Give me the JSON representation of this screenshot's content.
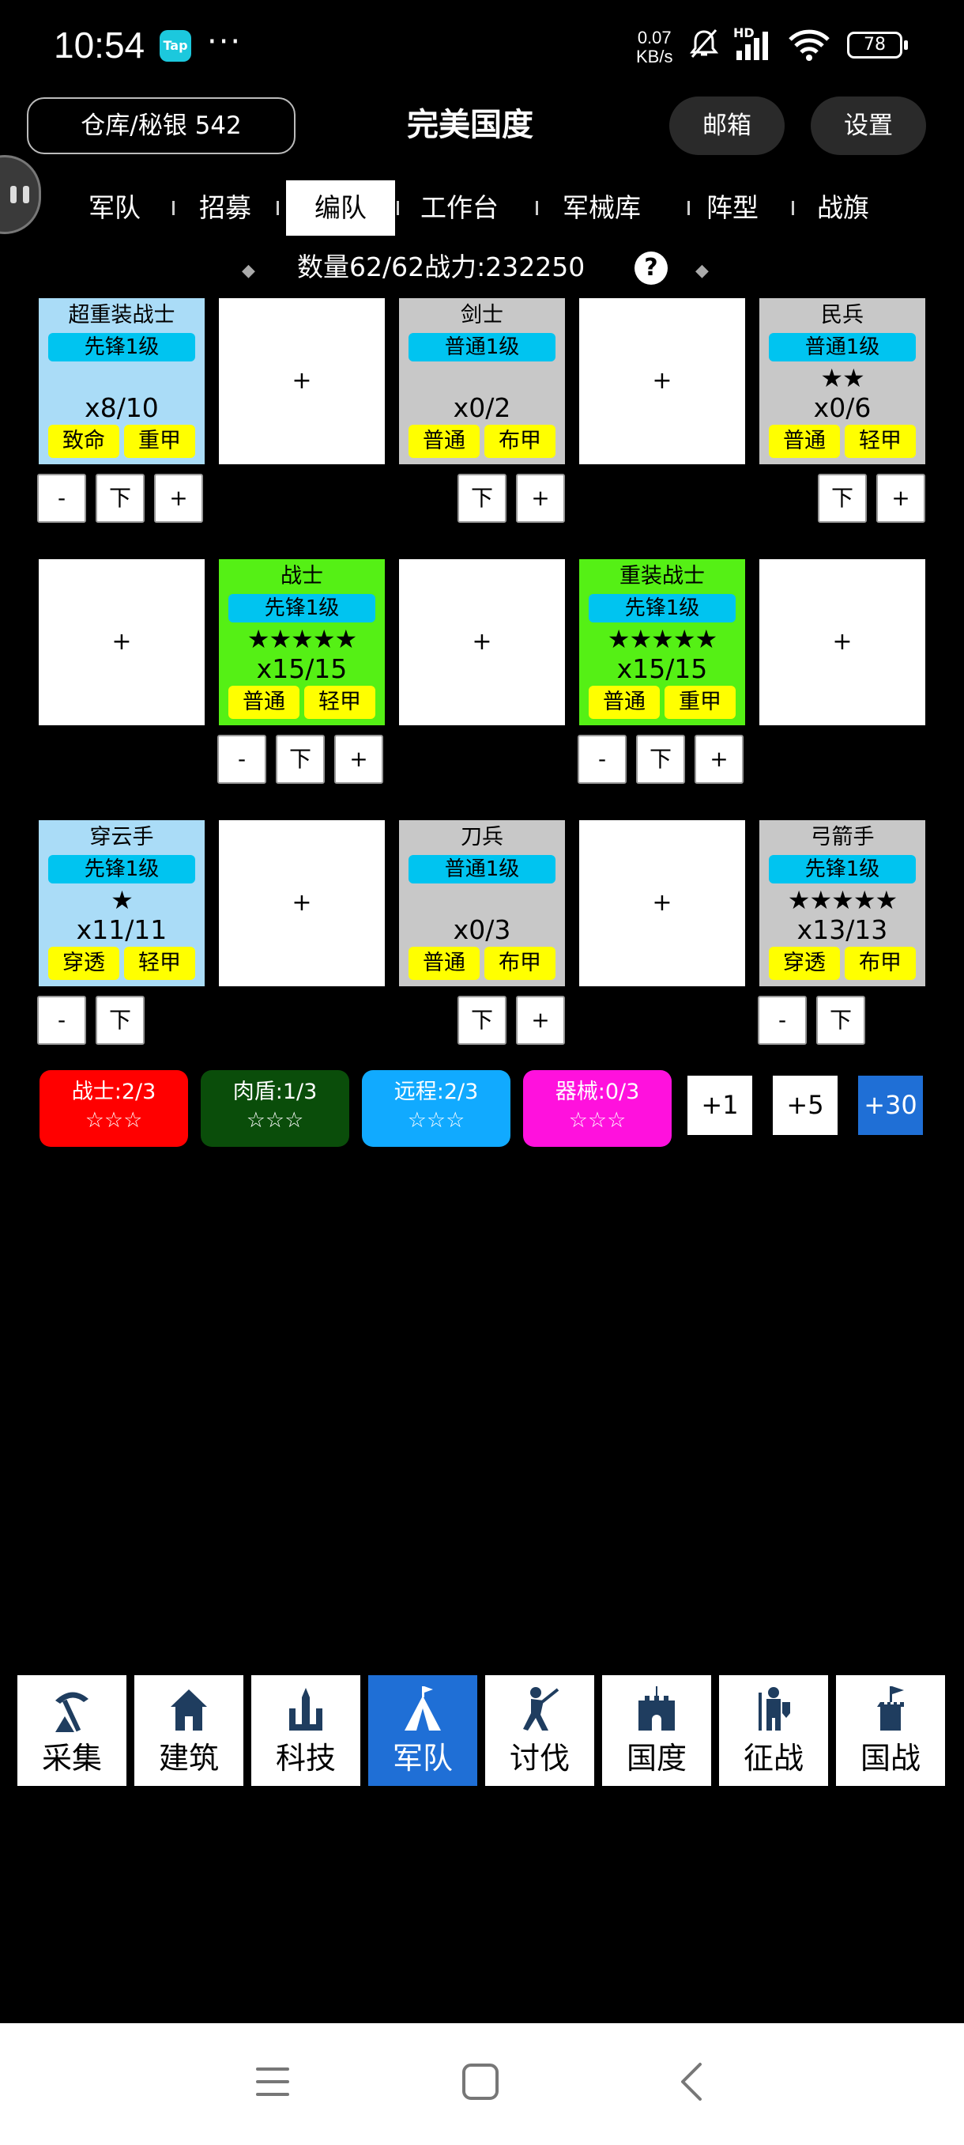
{
  "status_bar": {
    "time": "10:54",
    "tap_label": "Tap",
    "more": "···",
    "speed_value": "0.07",
    "speed_unit": "KB/s",
    "network_label": "HD",
    "battery": "78"
  },
  "header": {
    "warehouse": "仓库/秘银 542",
    "title": "完美国度",
    "mailbox": "邮箱",
    "settings": "设置"
  },
  "tabs": [
    {
      "label": "军队"
    },
    {
      "label": "招募"
    },
    {
      "label": "编队",
      "active": true
    },
    {
      "label": "工作台"
    },
    {
      "label": "军械库"
    },
    {
      "label": "阵型"
    },
    {
      "label": "战旗"
    }
  ],
  "summary": "数量62/62战力:232250",
  "help": "?",
  "slots": [
    {
      "name": "超重装战士",
      "rank": "先锋1级",
      "stars": "",
      "qty": "x8/10",
      "tags": [
        "致命",
        "重甲"
      ],
      "color": "#aadcf7",
      "buttons": [
        "-",
        "下",
        "+"
      ]
    },
    {
      "empty": "+"
    },
    {
      "name": "剑士",
      "rank": "普通1级",
      "stars": "",
      "qty": "x0/2",
      "tags": [
        "普通",
        "布甲"
      ],
      "color": "#c8c8c8",
      "buttons": [
        "下",
        "+"
      ]
    },
    {
      "empty": "+"
    },
    {
      "name": "民兵",
      "rank": "普通1级",
      "stars": "★★",
      "qty": "x0/6",
      "tags": [
        "普通",
        "轻甲"
      ],
      "color": "#c8c8c8",
      "buttons": [
        "下",
        "+"
      ]
    },
    {
      "empty": "+"
    },
    {
      "name": "战士",
      "rank": "先锋1级",
      "stars": "★★★★★",
      "qty": "x15/15",
      "tags": [
        "普通",
        "轻甲"
      ],
      "color": "#55f015",
      "buttons": [
        "-",
        "下",
        "+"
      ]
    },
    {
      "empty": "+"
    },
    {
      "name": "重装战士",
      "rank": "先锋1级",
      "stars": "★★★★★",
      "qty": "x15/15",
      "tags": [
        "普通",
        "重甲"
      ],
      "color": "#55f015",
      "buttons": [
        "-",
        "下",
        "+"
      ]
    },
    {
      "empty": "+"
    },
    {
      "name": "穿云手",
      "rank": "先锋1级",
      "stars": "★",
      "qty": "x11/11",
      "tags": [
        "穿透",
        "轻甲"
      ],
      "color": "#aadcf7",
      "buttons": [
        "-",
        "下"
      ]
    },
    {
      "empty": "+"
    },
    {
      "name": "刀兵",
      "rank": "普通1级",
      "stars": "",
      "qty": "x0/3",
      "tags": [
        "普通",
        "布甲"
      ],
      "color": "#c8c8c8",
      "buttons": [
        "下",
        "+"
      ]
    },
    {
      "empty": "+"
    },
    {
      "name": "弓箭手",
      "rank": "先锋1级",
      "stars": "★★★★★",
      "qty": "x13/13",
      "tags": [
        "穿透",
        "布甲"
      ],
      "color": "#c8c8c8",
      "buttons": [
        "-",
        "下"
      ]
    }
  ],
  "class_limits": [
    {
      "label": "战士:2/3",
      "stars": "☆☆☆",
      "color": "#ff0000"
    },
    {
      "label": "肉盾:1/3",
      "stars": "☆☆☆",
      "color": "#0a4d0a"
    },
    {
      "label": "远程:2/3",
      "stars": "☆☆☆",
      "color": "#11aaff"
    },
    {
      "label": "器械:0/3",
      "stars": "☆☆☆",
      "color": "#ff11dd"
    }
  ],
  "steps": [
    "+1",
    "+5",
    "+30"
  ],
  "bottom_nav": [
    {
      "label": "采集",
      "icon": "pickaxe-icon"
    },
    {
      "label": "建筑",
      "icon": "house-icon"
    },
    {
      "label": "科技",
      "icon": "tech-icon"
    },
    {
      "label": "军队",
      "icon": "tent-icon",
      "active": true
    },
    {
      "label": "讨伐",
      "icon": "attack-icon"
    },
    {
      "label": "国度",
      "icon": "castle-icon"
    },
    {
      "label": "征战",
      "icon": "warrior-icon"
    },
    {
      "label": "国战",
      "icon": "flag-tower-icon"
    }
  ]
}
